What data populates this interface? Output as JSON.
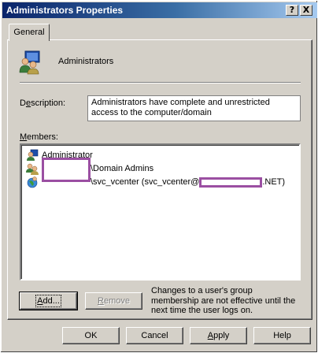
{
  "window": {
    "title": "Administrators Properties",
    "help_glyph": "?",
    "close_glyph": "X"
  },
  "tabs": [
    {
      "label": "General",
      "active": true
    }
  ],
  "group": {
    "name": "Administrators",
    "icon": "group-icon"
  },
  "description": {
    "label_pre": "D",
    "label_ul": "e",
    "label_post": "scription:",
    "value": "Administrators have complete and unrestricted access to the computer/domain"
  },
  "members": {
    "label_ul": "M",
    "label_post": "embers:",
    "items": [
      {
        "icon": "user-icon",
        "text": "Administrator"
      },
      {
        "icon": "group-icon",
        "suffix": "\\Domain Admins"
      },
      {
        "icon": "user-globe-icon",
        "suffix": "\\svc_vcenter (svc_vcenter@",
        "suffix2": ".NET)"
      }
    ]
  },
  "info_text": "Changes to a user's group membership are not effective until the next time the user logs on.",
  "buttons": {
    "add": {
      "pre": "",
      "ul": "A",
      "post": "dd..."
    },
    "remove": {
      "pre": "",
      "ul": "R",
      "post": "emove"
    },
    "ok": "OK",
    "cancel": "Cancel",
    "apply": {
      "pre": "",
      "ul": "A",
      "post": "pply"
    },
    "help": "Help"
  },
  "colors": {
    "title_start": "#0a246a",
    "title_end": "#a6caf0",
    "face": "#d4d0c8",
    "redaction": "#9b4fa2"
  }
}
